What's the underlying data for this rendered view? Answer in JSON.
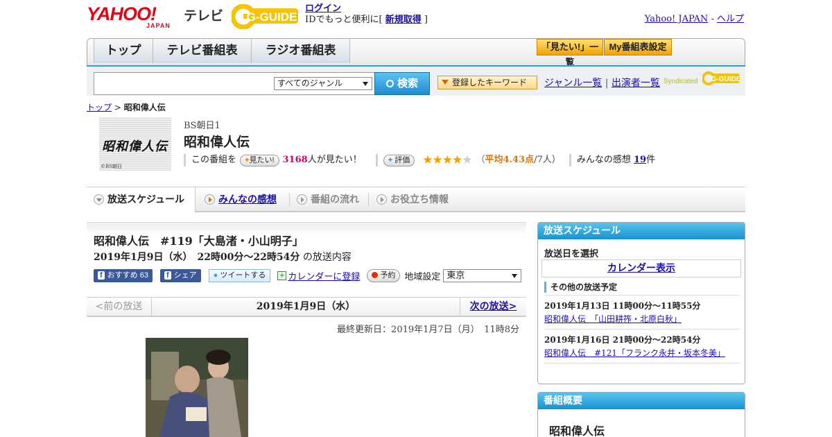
{
  "header": {
    "yahoo_logo": "YAHOO!",
    "yahoo_japan": "JAPAN",
    "tv_label": "テレビ",
    "gguide_logo": "G-GUIDE",
    "login_link": "ログイン",
    "id_prefix": "IDでもっと便利に[ ",
    "register_link": "新規取得",
    "id_suffix": " ]",
    "yahoo_japan_link": "Yahoo! JAPAN",
    "sep": " - ",
    "help_link": "ヘルプ"
  },
  "nav": {
    "tabs": [
      {
        "label": "トップ"
      },
      {
        "label": "テレビ番組表"
      },
      {
        "label": "ラジオ番組表"
      }
    ],
    "mitai_list": "「見たい!」一覧",
    "my_schedule": "My番組表設定"
  },
  "search": {
    "genre": "すべてのジャンル",
    "button": "検索",
    "keyword_button": "登録したキーワード",
    "genre_list_link": "ジャンル一覧",
    "divider": "|",
    "cast_list_link": "出演者一覧",
    "syndicated": "Syndicated"
  },
  "breadcrumb": {
    "top": "トップ",
    "sep": " > ",
    "current": "昭和偉人伝"
  },
  "program": {
    "thumb_text": "昭和偉人伝",
    "thumb_copyright": "©BS朝日",
    "channel": "BS朝日1",
    "title": "昭和偉人伝",
    "mitai_prefix": "この番組を",
    "mitai_button": "見たい!",
    "mitai_count": "3168",
    "mitai_suffix": "人が見たい！",
    "rating_button": "評価",
    "rating_stars": 4,
    "rating_open": "（",
    "rating_label": "平均4.43点",
    "rating_count": "/7人）",
    "comments_label": "みんなの感想",
    "comments_count": "19",
    "comments_unit": "件"
  },
  "tabs": [
    {
      "label": "放送スケジュール"
    },
    {
      "label": "みんなの感想"
    },
    {
      "label": "番組の流れ"
    },
    {
      "label": "お役立ち情報"
    }
  ],
  "episode": {
    "title": "昭和偉人伝　#119「大島渚・小山明子」",
    "datetime": "2019年1月9日（水）　22時00分～22時54分",
    "datetime_suffix": " の放送内容",
    "fb_recommend": "おすすめ",
    "fb_count": "63",
    "fb_share": "シェア",
    "tweet": "ツイートする",
    "calendar_register": "カレンダーに登録",
    "reserve": "予約",
    "region_label": "地域設定",
    "region_value": "東京"
  },
  "pager": {
    "prev": "<前の放送",
    "current": "2019年1月9日（水）",
    "next": "次の放送>"
  },
  "updated": "最終更新日：2019年1月7日（月）　11時8分",
  "sidebar": {
    "schedule_header": "放送スケジュール",
    "select_date": "放送日を選択",
    "calendar_button": "カレンダー表示",
    "other_header": "その他の放送予定",
    "other": [
      {
        "date": "2019年1月13日  11時00分～11時55分",
        "title": "昭和偉人伝　「山田耕筰・北原白秋」"
      },
      {
        "date": "2019年1月16日  21時00分～22時54分",
        "title": "昭和偉人伝　#121「フランク永井・坂本冬美」"
      }
    ],
    "summary_header": "番組概要",
    "summary_title": "昭和偉人伝"
  },
  "colors": {
    "accent_blue": "#2ba0d8",
    "yahoo_red": "#e60012",
    "star": "#f3a000",
    "mitai_count": "#d4006a"
  }
}
